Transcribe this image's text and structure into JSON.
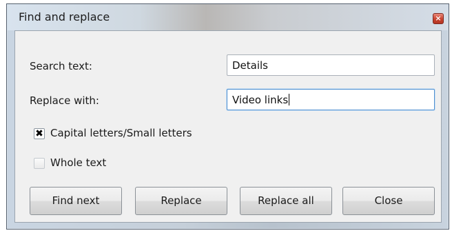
{
  "window": {
    "title": "Find and replace",
    "close_glyph": "×"
  },
  "form": {
    "search_label": "Search text:",
    "search_value": "Details",
    "replace_label": "Replace with:",
    "replace_value": "Video links",
    "case_option": {
      "checked": true,
      "mark": "✖",
      "label": "Capital letters/Small letters"
    },
    "whole_option": {
      "checked": false,
      "label": "Whole text"
    }
  },
  "buttons": {
    "find_next": "Find next",
    "replace": "Replace",
    "replace_all": "Replace all",
    "close": "Close"
  },
  "colors": {
    "dialog_background": "#f0f0f0",
    "focus_border": "#4e8fcf",
    "close_button": "#c8422f"
  }
}
